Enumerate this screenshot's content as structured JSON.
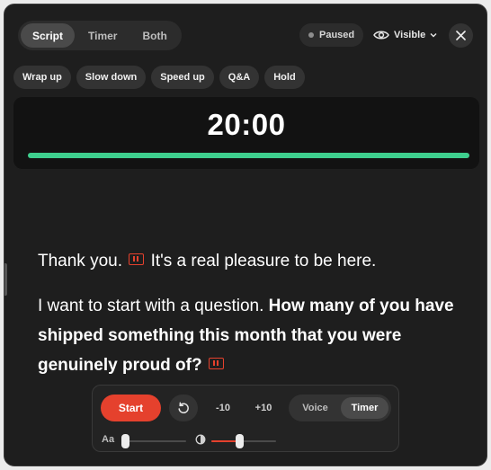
{
  "mode_tabs": [
    {
      "label": "Script",
      "active": true
    },
    {
      "label": "Timer",
      "active": false
    },
    {
      "label": "Both",
      "active": false
    }
  ],
  "status": {
    "label": "Paused",
    "dot_color": "#8d8d8d"
  },
  "visibility": {
    "label": "Visible",
    "icon": "eye-icon"
  },
  "close": {
    "icon": "close-icon"
  },
  "quick_actions": [
    "Wrap up",
    "Slow down",
    "Speed up",
    "Q&A",
    "Hold"
  ],
  "timer": {
    "value": "20:00",
    "progress": 1.0,
    "progress_color": "#3ecf8e"
  },
  "script": {
    "line1_a": "Thank you.",
    "line1_b": "It's a real pleasure to be here.",
    "line2_a": "I want to start with a question.",
    "line2_b": "How many of you have shipped something this month that you were genuinely proud of?"
  },
  "controls": {
    "start_label": "Start",
    "reset_icon": "reset-icon",
    "minus_label": "-10",
    "plus_label": "+10",
    "output_modes": [
      {
        "label": "Voice",
        "active": false
      },
      {
        "label": "Timer",
        "active": true
      }
    ],
    "font_size_label": "Aa",
    "font_size_level": 0.0,
    "contrast_icon": "contrast-icon",
    "contrast_level": 0.43
  },
  "colors": {
    "accent": "#e5412d",
    "progress": "#3ecf8e",
    "panel": "#1e1e1e"
  }
}
